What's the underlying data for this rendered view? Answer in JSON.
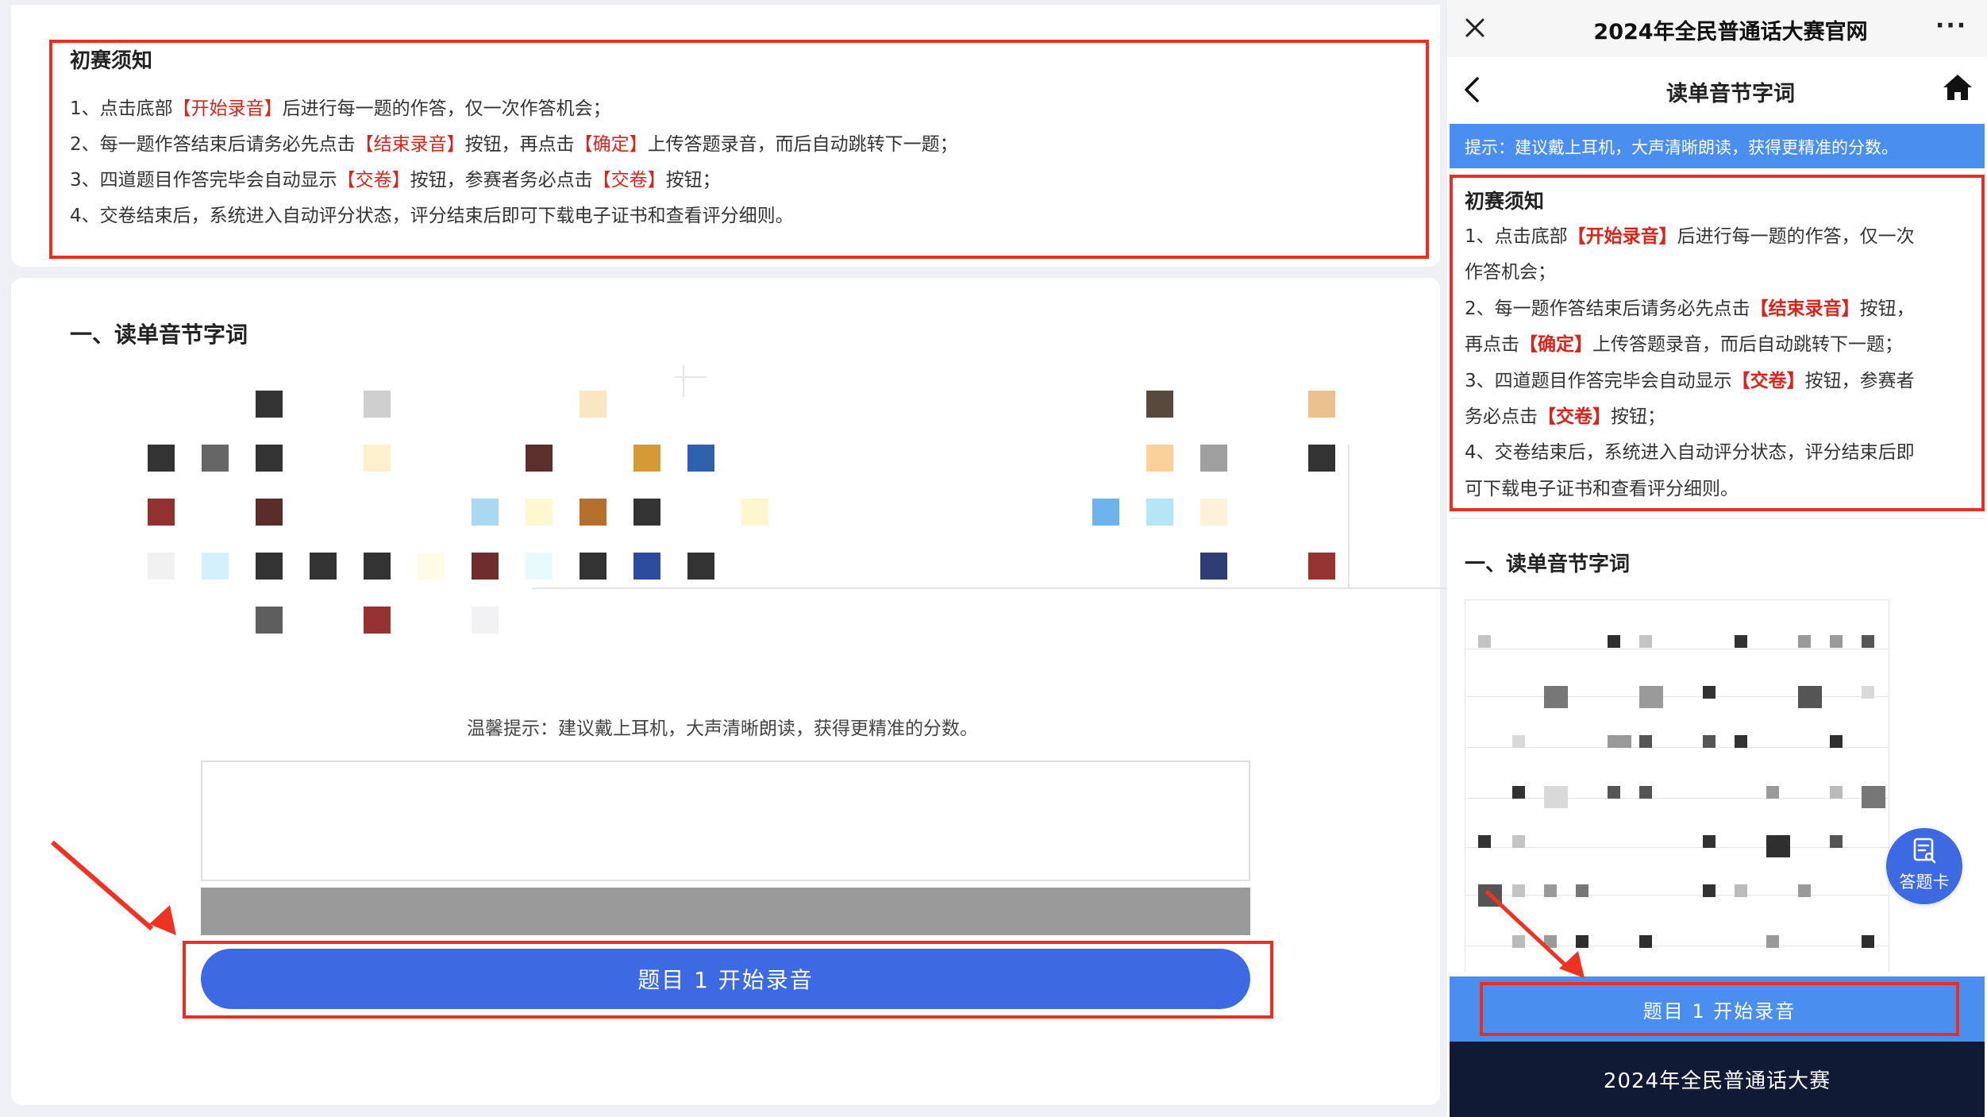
{
  "left": {
    "rules_title": "初赛须知",
    "rules": [
      {
        "pre": "1、点击底部",
        "hl": "【开始录音】",
        "post": "后进行每一题的作答，仅一次作答机会；"
      },
      {
        "pre": "2、每一题作答结束后请务必先点击",
        "hl": "【结束录音】",
        "mid": "按钮，再点击",
        "hl2": "【确定】",
        "post": "上传答题录音，而后自动跳转下一题；"
      },
      {
        "pre": "3、四道题目作答完毕会自动显示",
        "hl": "【交卷】",
        "mid": "按钮，参赛者务必点击",
        "hl2": "【交卷】",
        "post": "按钮；"
      },
      {
        "pre": "4、交卷结束后，系统进入自动评分状态，评分结束后即可下载电子证书和查看评分细则。"
      }
    ],
    "section_title": "一、读单音节字词",
    "tip": "温馨提示：建议戴上耳机，大声清晰朗读，获得更精准的分数。",
    "record_button": "题目 1 开始录音"
  },
  "mobile": {
    "window_title": "2024年全民普通话大赛官网",
    "page_title": "读单音节字词",
    "tip_banner": "提示：建议戴上耳机，大声清晰朗读，获得更精准的分数。",
    "rules_title": "初赛须知",
    "rules_lines": [
      [
        {
          "t": "1、点击底部"
        },
        {
          "t": "【开始录音】",
          "hl": true
        },
        {
          "t": "后进行每一题的作答，仅一次"
        }
      ],
      [
        {
          "t": "作答机会；"
        }
      ],
      [
        {
          "t": "2、每一题作答结束后请务必先点击"
        },
        {
          "t": "【结束录音】",
          "hl": true
        },
        {
          "t": "按钮，"
        }
      ],
      [
        {
          "t": "再点击"
        },
        {
          "t": "【确定】",
          "hl": true
        },
        {
          "t": "上传答题录音，而后自动跳转下一题；"
        }
      ],
      [
        {
          "t": "3、四道题目作答完毕会自动显示"
        },
        {
          "t": "【交卷】",
          "hl": true
        },
        {
          "t": "按钮，参赛者"
        }
      ],
      [
        {
          "t": "务必点击"
        },
        {
          "t": "【交卷】",
          "hl": true
        },
        {
          "t": "按钮；"
        }
      ],
      [
        {
          "t": "4、交卷结束后，系统进入自动评分状态，评分结束后即"
        }
      ],
      [
        {
          "t": "可下载电子证书和查看评分细则。"
        }
      ]
    ],
    "section_title": "一、读单音节字词",
    "answer_card": "答题卡",
    "record_button": "题目 1 开始录音",
    "footer": "2024年全民普通话大赛"
  },
  "icons": {
    "close": "close-icon",
    "more": "more-icon",
    "back": "back-chevron-icon",
    "home": "home-icon",
    "answer_card": "answer-card-icon"
  },
  "colors": {
    "accent_blue": "#3d6ae3",
    "highlight_red": "#e0221b",
    "annotation_red": "#ea2f22",
    "mobile_banner": "#4a8ef0",
    "footer_dark": "#101a35"
  }
}
